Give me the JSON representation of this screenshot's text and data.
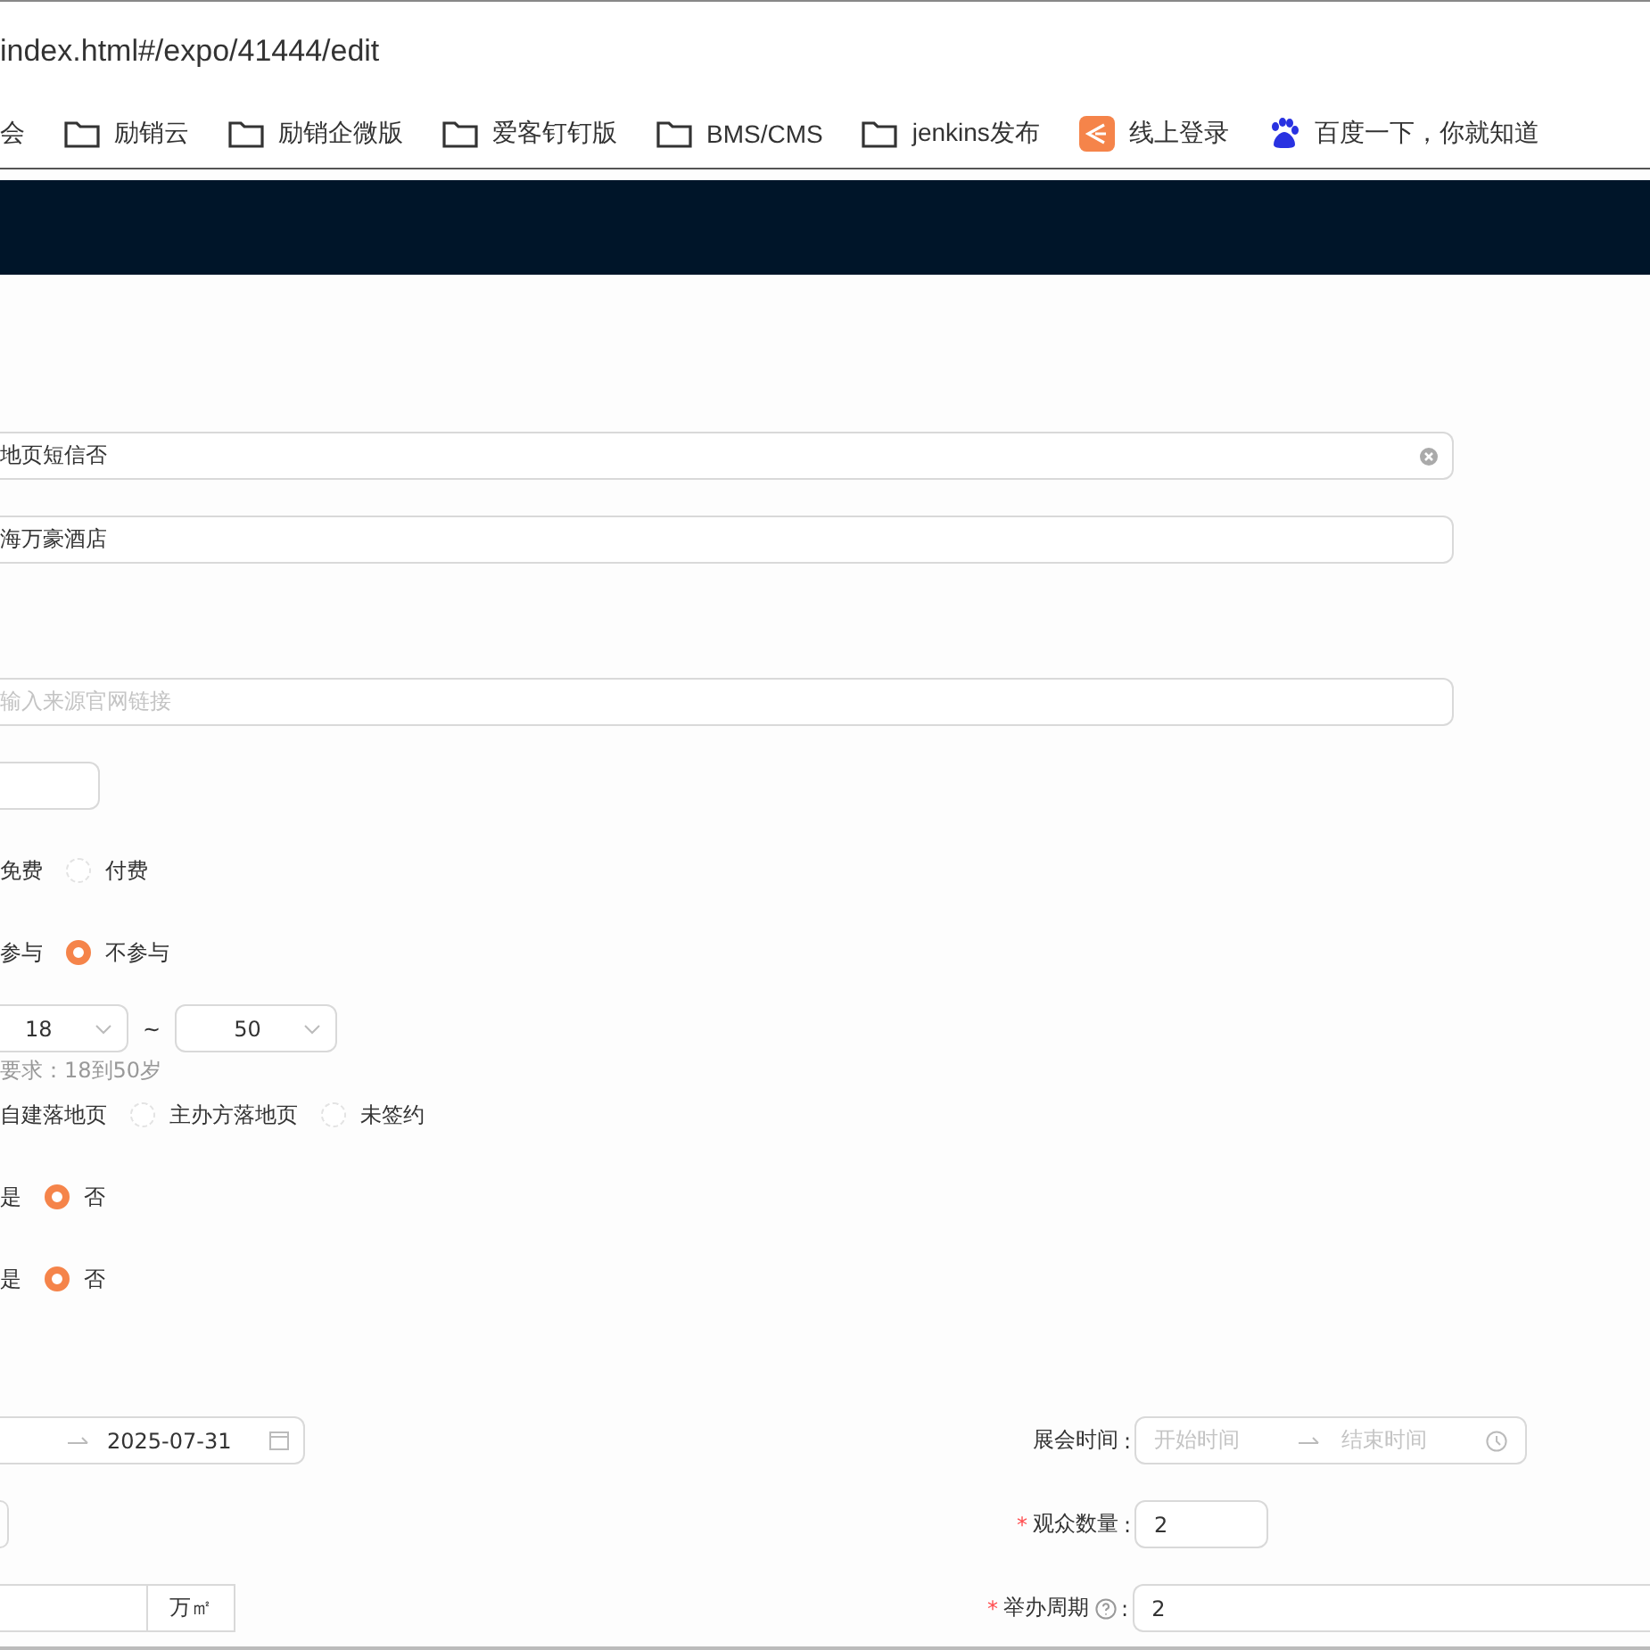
{
  "browser": {
    "url": "index.html#/expo/41444/edit",
    "bookmarks": [
      {
        "label": "会",
        "kind": "text"
      },
      {
        "label": "励销云",
        "kind": "folder"
      },
      {
        "label": "励销企微版",
        "kind": "folder"
      },
      {
        "label": "爱客钉钉版",
        "kind": "folder"
      },
      {
        "label": "BMS/CMS",
        "kind": "folder"
      },
      {
        "label": "jenkins发布",
        "kind": "folder"
      },
      {
        "label": "线上登录",
        "kind": "app"
      },
      {
        "label": "百度一下，你就知道",
        "kind": "paw"
      }
    ]
  },
  "form": {
    "rows": [
      {
        "kind": "input",
        "value": "地页短信否",
        "clearable": true
      },
      {
        "kind": "input",
        "value": "海万豪酒店"
      },
      {
        "kind": "input",
        "placeholder": "输入来源官网链接"
      },
      {
        "kind": "short-input"
      },
      {
        "kind": "radios",
        "leading": "免费",
        "options": [
          {
            "label": "付费",
            "selected": false
          }
        ]
      },
      {
        "kind": "radios",
        "leading": "参与",
        "options": [
          {
            "label": "不参与",
            "selected": true
          }
        ]
      },
      {
        "kind": "range-select",
        "from": "18",
        "separator": "~",
        "to": "50"
      },
      {
        "kind": "hint",
        "text": "要求：18到50岁"
      },
      {
        "kind": "radios",
        "leading": "自建落地页",
        "options": [
          {
            "label": "主办方落地页",
            "selected": false
          },
          {
            "label": "未签约",
            "selected": false
          }
        ]
      },
      {
        "kind": "radios",
        "leading": "是",
        "options": [
          {
            "label": "否",
            "selected": true
          }
        ]
      },
      {
        "kind": "radios",
        "leading": "是",
        "options": [
          {
            "label": "否",
            "selected": true
          }
        ]
      },
      {
        "kind": "date-range",
        "end": "2025-07-31",
        "right": {
          "label": "展会时间",
          "colon": ":",
          "kind": "time-range",
          "start_placeholder": "开始时间",
          "end_placeholder": "结束时间"
        }
      },
      {
        "kind": "stub",
        "right": {
          "label": "观众数量",
          "colon": ":",
          "required_mark": "*",
          "kind": "input",
          "value": "2"
        }
      },
      {
        "kind": "addon-input",
        "addon": "万㎡",
        "right": {
          "label": "举办周期",
          "colon": ":",
          "required_mark": "*",
          "help": true,
          "kind": "wide-input",
          "value": "2"
        }
      }
    ]
  }
}
